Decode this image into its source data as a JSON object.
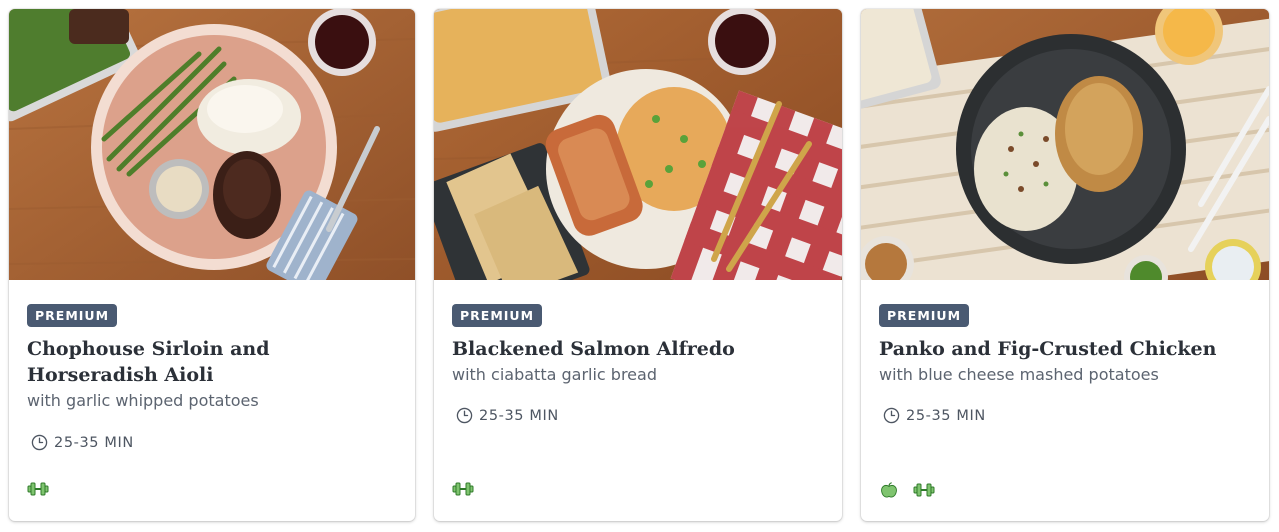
{
  "cards": [
    {
      "badge": "PREMIUM",
      "title": "Chophouse Sirloin and Horseradish Aioli",
      "subtitle": "with garlic whipped potatoes",
      "time": "25-35 MIN",
      "tags": [
        "dumbbell-icon"
      ]
    },
    {
      "badge": "PREMIUM",
      "title": "Blackened Salmon Alfredo",
      "subtitle": "with ciabatta garlic bread",
      "time": "25-35 MIN",
      "tags": [
        "dumbbell-icon"
      ]
    },
    {
      "badge": "PREMIUM",
      "title": "Panko and Fig-Crusted Chicken",
      "subtitle": "with blue cheese mashed potatoes",
      "time": "25-35 MIN",
      "tags": [
        "apple-icon",
        "dumbbell-icon"
      ]
    }
  ],
  "colors": {
    "badge_bg": "#4a5a72",
    "tag_green": "#3f9a3a",
    "text_dark": "#2b3038",
    "text_muted": "#5c6470"
  }
}
